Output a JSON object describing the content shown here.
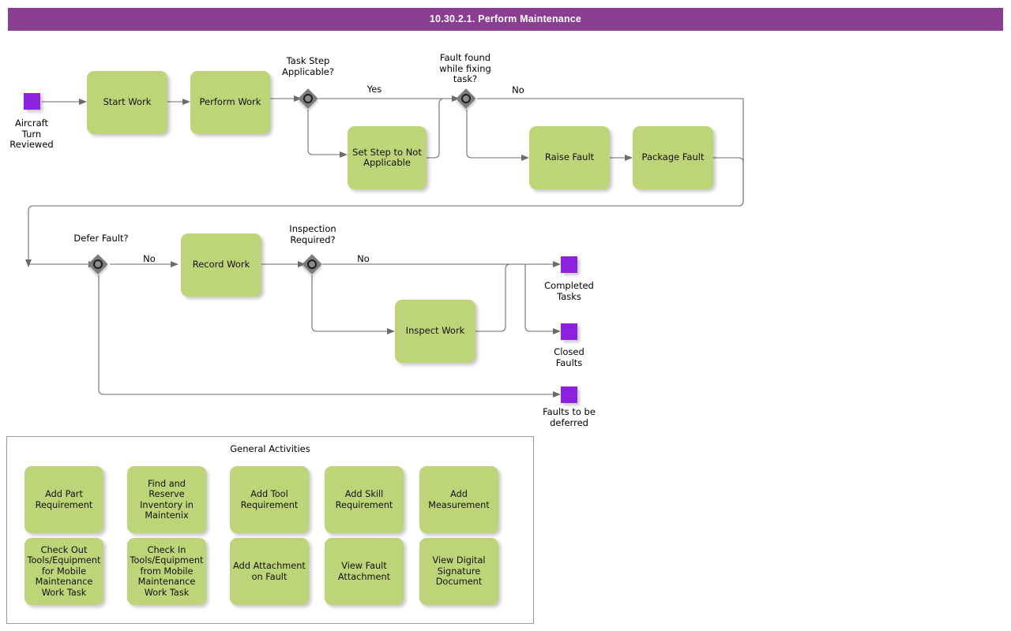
{
  "header": {
    "title": "10.30.2.1. Perform Maintenance"
  },
  "diagram": {
    "start_events": [
      {
        "name": "aircraft-turn-reviewed",
        "label": "Aircraft\nTurn\nReviewed"
      }
    ],
    "tasks": [
      {
        "id": "start-work",
        "label": "Start Work"
      },
      {
        "id": "perform-work",
        "label": "Perform Work"
      },
      {
        "id": "set-step-not-applicable",
        "label": "Set Step to Not\nApplicable"
      },
      {
        "id": "raise-fault",
        "label": "Raise Fault"
      },
      {
        "id": "package-fault",
        "label": "Package Fault"
      },
      {
        "id": "record-work",
        "label": "Record Work"
      },
      {
        "id": "inspect-work",
        "label": "Inspect Work"
      }
    ],
    "gateways": [
      {
        "id": "task-step-applicable",
        "label": "Task Step\nApplicable?"
      },
      {
        "id": "fault-found",
        "label": "Fault found\nwhile fixing\ntask?"
      },
      {
        "id": "defer-fault",
        "label": "Defer Fault?"
      },
      {
        "id": "inspection-required",
        "label": "Inspection\nRequired?"
      }
    ],
    "flow_labels": [
      {
        "id": "yes-task-step-applicable",
        "label": "Yes"
      },
      {
        "id": "no-fault-found",
        "label": "No"
      },
      {
        "id": "no-defer-fault",
        "label": "No"
      },
      {
        "id": "no-inspection-required",
        "label": "No"
      }
    ],
    "end_events": [
      {
        "id": "completed-tasks",
        "label": "Completed\nTasks"
      },
      {
        "id": "closed-faults",
        "label": "Closed\nFaults"
      },
      {
        "id": "faults-to-be-deferred",
        "label": "Faults to be\ndeferred"
      }
    ]
  },
  "general_activities": {
    "title": "General Activities",
    "items": [
      {
        "id": "add-part-requirement",
        "label": "Add Part\nRequirement"
      },
      {
        "id": "find-reserve-inventory",
        "label": "Find and\nReserve\nInventory in\nMaintenix"
      },
      {
        "id": "add-tool-requirement",
        "label": "Add Tool\nRequirement"
      },
      {
        "id": "add-skill-requirement",
        "label": "Add Skill\nRequirement"
      },
      {
        "id": "add-measurement",
        "label": "Add\nMeasurement"
      },
      {
        "id": "check-out-tools",
        "label": "Check Out\nTools/Equipment\nfor Mobile\nMaintenance\nWork Task"
      },
      {
        "id": "check-in-tools",
        "label": "Check In\nTools/Equipment\nfrom Mobile\nMaintenance\nWork Task"
      },
      {
        "id": "add-attachment-on-fault",
        "label": "Add Attachment\non Fault"
      },
      {
        "id": "view-fault-attachment",
        "label": "View Fault\nAttachment"
      },
      {
        "id": "view-digital-signature",
        "label": "View Digital\nSignature\nDocument"
      }
    ]
  },
  "colors": {
    "header_purple": "#8A3E92",
    "task_green": "#bdd578",
    "event_purple": "#8C22DD",
    "gateway_gray": "#7c7c7c",
    "connector_gray": "#6b6b6b"
  }
}
